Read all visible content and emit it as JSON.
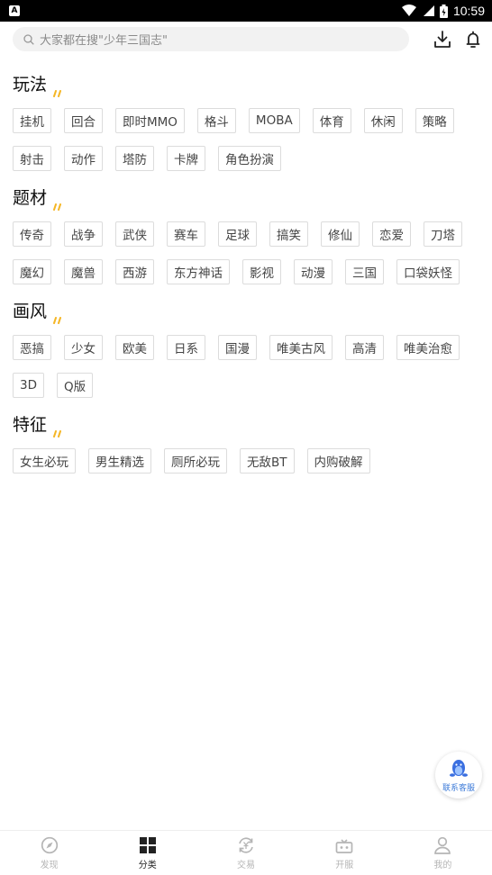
{
  "status_bar": {
    "time": "10:59",
    "app_badge": "A"
  },
  "search": {
    "placeholder": "大家都在搜\"少年三国志\""
  },
  "sections": [
    {
      "title": "玩法",
      "tags": [
        "挂机",
        "回合",
        "即时MMO",
        "格斗",
        "MOBA",
        "体育",
        "休闲",
        "策略",
        "射击",
        "动作",
        "塔防",
        "卡牌",
        "角色扮演"
      ]
    },
    {
      "title": "题材",
      "tags": [
        "传奇",
        "战争",
        "武侠",
        "赛车",
        "足球",
        "搞笑",
        "修仙",
        "恋爱",
        "刀塔",
        "魔幻",
        "魔兽",
        "西游",
        "东方神话",
        "影视",
        "动漫",
        "三国",
        "口袋妖怪"
      ]
    },
    {
      "title": "画风",
      "tags": [
        "恶搞",
        "少女",
        "欧美",
        "日系",
        "国漫",
        "唯美古风",
        "高清",
        "唯美治愈",
        "3D",
        "Q版"
      ]
    },
    {
      "title": "特征",
      "tags": [
        "女生必玩",
        "男生精选",
        "厕所必玩",
        "无敌BT",
        "内购破解"
      ]
    }
  ],
  "support": {
    "label": "联系客服"
  },
  "bottom_nav": [
    {
      "label": "发现",
      "icon": "compass-icon",
      "active": false
    },
    {
      "label": "分类",
      "icon": "grid-icon",
      "active": true
    },
    {
      "label": "交易",
      "icon": "exchange-icon",
      "active": false
    },
    {
      "label": "开服",
      "icon": "server-icon",
      "active": false
    },
    {
      "label": "我的",
      "icon": "user-icon",
      "active": false
    }
  ],
  "colors": {
    "accent": "#f5b625",
    "active_nav": "#222222",
    "inactive_nav": "#b5b5b5",
    "support_blue": "#3d7bd8"
  }
}
